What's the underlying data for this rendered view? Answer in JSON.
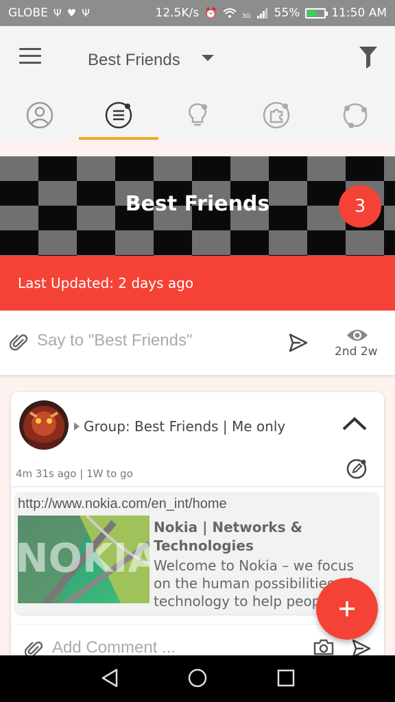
{
  "status_bar": {
    "carrier": "GLOBE",
    "speed": "12.5K/s",
    "network": "3G",
    "battery": "55%",
    "battery_level": 0.55,
    "time": "11:50 AM"
  },
  "app_bar": {
    "group_name": "Best Friends"
  },
  "tabs": [
    {
      "name": "profile",
      "icon": "person-circle-icon"
    },
    {
      "name": "feed",
      "icon": "list-circle-icon",
      "active": true
    },
    {
      "name": "ideas",
      "icon": "lightbulb-icon"
    },
    {
      "name": "puzzle",
      "icon": "puzzle-icon"
    },
    {
      "name": "network",
      "icon": "nodes-circle-icon"
    }
  ],
  "banner": {
    "title": "Best Friends",
    "badge_count": "3"
  },
  "updated": {
    "text": "Last Updated: 2 days ago"
  },
  "composer": {
    "placeholder": "Say to \"Best Friends\"",
    "visibility_label": "2nd 2w"
  },
  "post": {
    "target": "Group: Best Friends | Me only",
    "time": "4m 31s ago | 1W to go",
    "link": {
      "url": "http://www.nokia.com/en_int/home",
      "title": "Nokia | Networks & Technologies",
      "description": "Welcome to Nokia – we focus on the human possibilities of technology to help people"
    },
    "comment_placeholder": "Add Comment ..."
  },
  "colors": {
    "accent_red": "#f44336",
    "tab_indicator": "#f5a623",
    "header_bg": "#f4f4f4",
    "page_bg": "#fdf2ef"
  }
}
